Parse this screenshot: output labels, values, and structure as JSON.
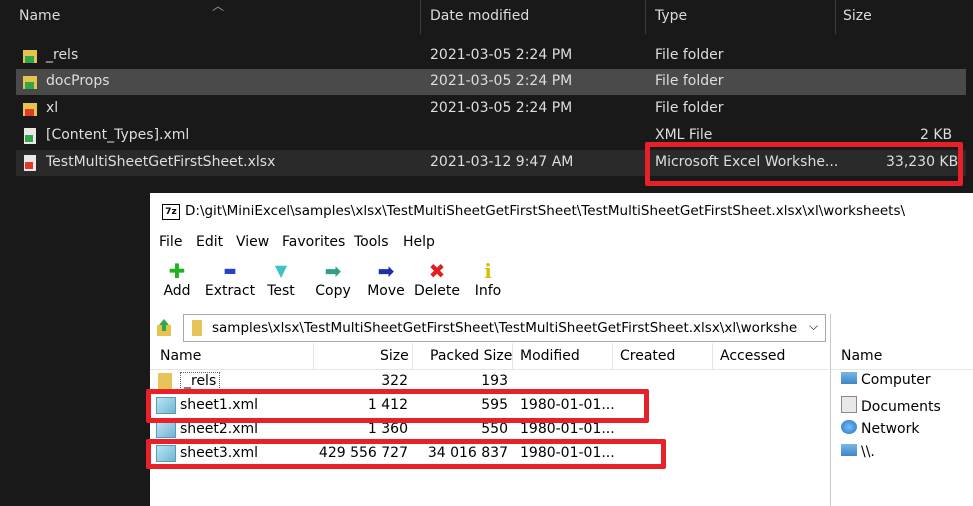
{
  "explorer": {
    "columns": {
      "name": "Name",
      "date": "Date modified",
      "type": "Type",
      "size": "Size"
    },
    "rows": [
      {
        "name": "_rels",
        "date": "2021-03-05 2:24 PM",
        "type": "File folder",
        "size": ""
      },
      {
        "name": "docProps",
        "date": "2021-03-05 2:24 PM",
        "type": "File folder",
        "size": ""
      },
      {
        "name": "xl",
        "date": "2021-03-05 2:24 PM",
        "type": "File folder",
        "size": ""
      },
      {
        "name": "[Content_Types].xml",
        "date": "",
        "type": "XML File",
        "size": "2 KB"
      },
      {
        "name": "TestMultiSheetGetFirstSheet.xlsx",
        "date": "2021-03-12 9:47 AM",
        "type": "Microsoft Excel Workshe...",
        "size": "33,230 KB"
      }
    ]
  },
  "sevenzip": {
    "title": "D:\\git\\MiniExcel\\samples\\xlsx\\TestMultiSheetGetFirstSheet\\TestMultiSheetGetFirstSheet.xlsx\\xl\\worksheets\\",
    "app_icon": "7z",
    "menu": [
      "File",
      "Edit",
      "View",
      "Favorites",
      "Tools",
      "Help"
    ],
    "toolbar": [
      {
        "label": "Add",
        "icon": "plus-icon",
        "glyph": "✚",
        "color": "#21b221"
      },
      {
        "label": "Extract",
        "icon": "minus-icon",
        "glyph": "▬",
        "color": "#2740c8"
      },
      {
        "label": "Test",
        "icon": "check-icon",
        "glyph": "▼",
        "color": "#3cc4c4"
      },
      {
        "label": "Copy",
        "icon": "copy-arrow-icon",
        "glyph": "➡",
        "color": "#2f9f8a"
      },
      {
        "label": "Move",
        "icon": "move-arrow-icon",
        "glyph": "➡",
        "color": "#1f2fa6"
      },
      {
        "label": "Delete",
        "icon": "delete-icon",
        "glyph": "✖",
        "color": "#e02020"
      },
      {
        "label": "Info",
        "icon": "info-icon",
        "glyph": "i",
        "color": "#d8c000"
      }
    ],
    "address": "samples\\xlsx\\TestMultiSheetGetFirstSheet\\TestMultiSheetGetFirstSheet.xlsx\\xl\\worksheets\\",
    "columns": {
      "name": "Name",
      "size": "Size",
      "packed": "Packed Size",
      "modified": "Modified",
      "created": "Created",
      "accessed": "Accessed"
    },
    "files": [
      {
        "name": "_rels",
        "size": "322",
        "packed": "193",
        "modified": ""
      },
      {
        "name": "sheet1.xml",
        "size": "1 412",
        "packed": "595",
        "modified": "1980-01-01..."
      },
      {
        "name": "sheet2.xml",
        "size": "1 360",
        "packed": "550",
        "modified": "1980-01-01..."
      },
      {
        "name": "sheet3.xml",
        "size": "429 556 727",
        "packed": "34 016 837",
        "modified": "1980-01-01..."
      }
    ],
    "side": {
      "header": "Name",
      "items": [
        "Computer",
        "Documents",
        "Network",
        "\\\\."
      ]
    }
  },
  "colors": {
    "highlight": "#e8202a",
    "explorer_bg": "#191919"
  }
}
